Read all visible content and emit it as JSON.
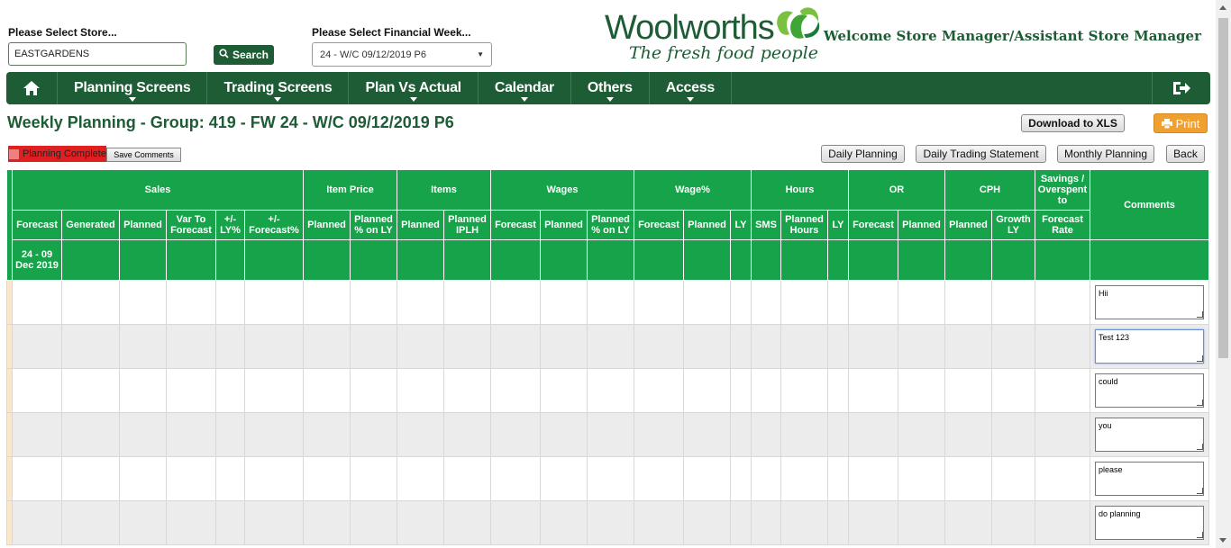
{
  "header": {
    "store_label": "Please Select Store...",
    "store_value": "EASTGARDENS",
    "search_label": "Search",
    "week_label": "Please Select Financial Week...",
    "week_value": "24 - W/C 09/12/2019 P6",
    "logo_word": "Woolworths",
    "logo_tagline": "The fresh food people",
    "welcome": "Welcome Store Manager/Assistant Store Manager"
  },
  "nav": {
    "items": [
      "Planning Screens",
      "Trading Screens",
      "Plan Vs Actual",
      "Calendar",
      "Others",
      "Access"
    ]
  },
  "page": {
    "title": "Weekly Planning - Group: 419 - FW 24 - W/C 09/12/2019 P6",
    "download_label": "Download to XLS",
    "print_label": "Print",
    "plan_complete_label": "Planning Complete",
    "save_comments_label": "Save Comments",
    "daily_planning_label": "Daily Planning",
    "daily_trading_label": "Daily Trading Statement",
    "monthly_planning_label": "Monthly Planning",
    "back_label": "Back"
  },
  "table": {
    "groups": [
      "Sales",
      "Item Price",
      "Items",
      "Wages",
      "Wage%",
      "Hours",
      "OR",
      "CPH",
      "Savings / Overspent to",
      "Comments"
    ],
    "subheaders": [
      "Forecast",
      "Generated",
      "Planned",
      "Var To Forecast",
      "+/- LY%",
      "+/- Forecast%",
      "Planned",
      "Planned % on LY",
      "Planned",
      "Planned IPLH",
      "Forecast",
      "Planned",
      "Planned % on LY",
      "Forecast",
      "Planned",
      "LY",
      "SMS",
      "Planned Hours",
      "LY",
      "Forecast",
      "Planned",
      "Planned",
      "Growth LY",
      "Forecast Rate"
    ],
    "week_cell": "24 - 09 Dec 2019",
    "comments": [
      "Hii",
      "Test 123",
      "could",
      "you",
      "please",
      "do planning"
    ]
  },
  "colors": {
    "brand_green": "#1d5c34",
    "table_green": "#16a34a",
    "print_orange": "#f0a030",
    "complete_red": "#e02020"
  }
}
